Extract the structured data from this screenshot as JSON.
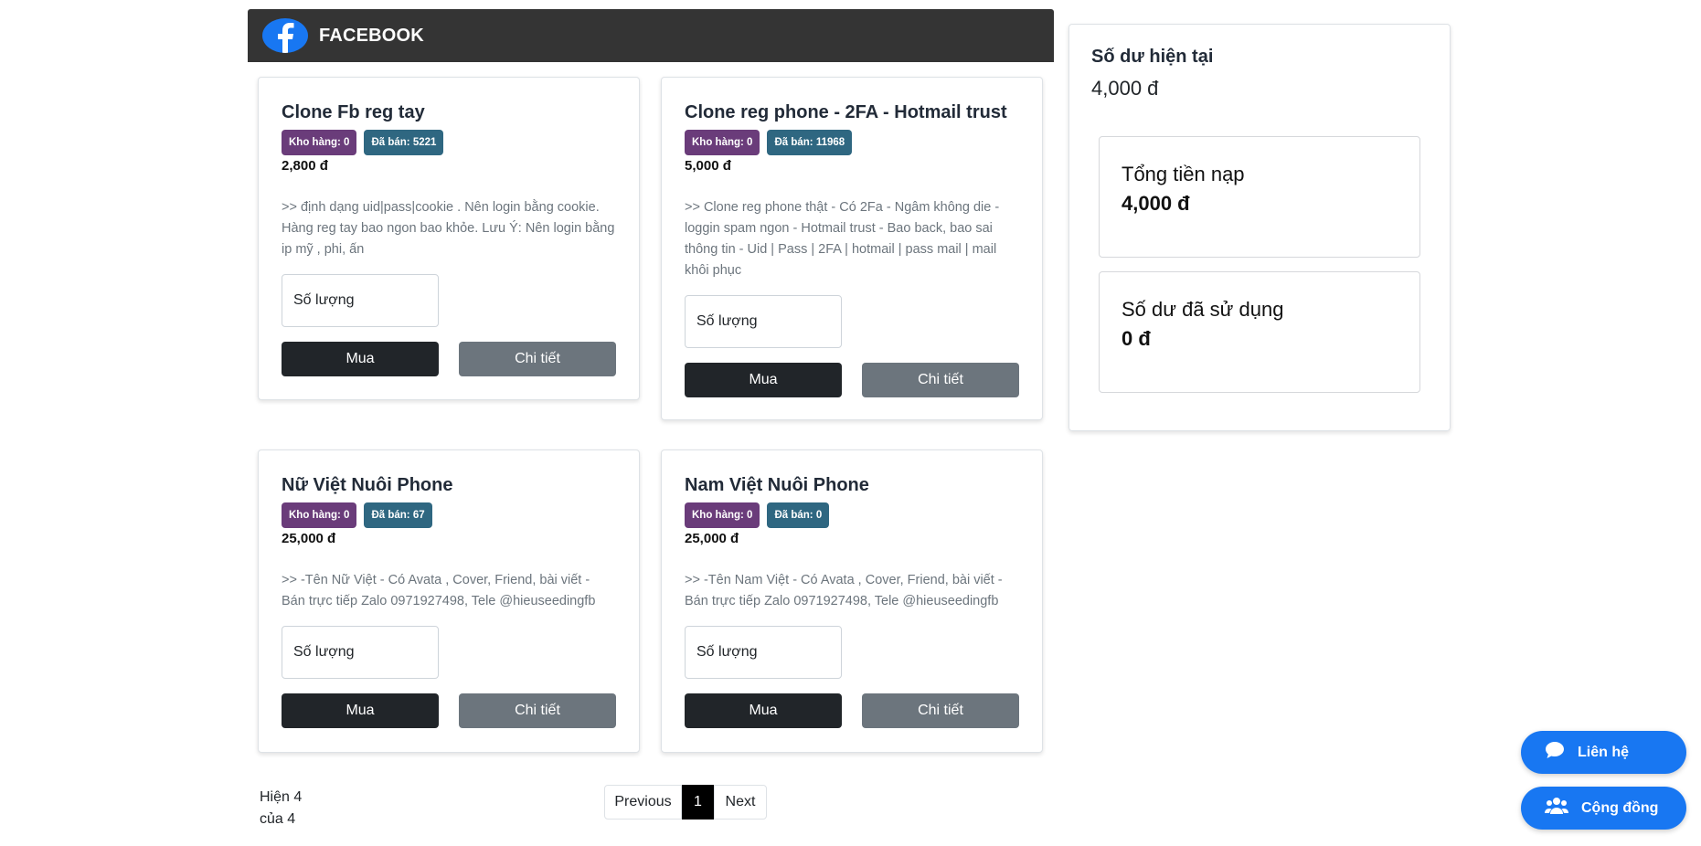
{
  "category": {
    "title": "FACEBOOK",
    "icon": "facebook-logo-icon"
  },
  "products": [
    {
      "name": "Clone Fb reg tay",
      "stock": "Kho hàng: 0",
      "sold": "Đã bán: 5221",
      "price": "2,800 đ",
      "description": ">> định dạng uid|pass|cookie . Nên login bằng cookie. Hàng reg tay bao ngon bao khỏe. Lưu Ý: Nên login bằng ip mỹ , phi, ấn",
      "quantity_placeholder": "Số lượng",
      "buy_label": "Mua",
      "detail_label": "Chi tiết"
    },
    {
      "name": "Clone reg phone - 2FA - Hotmail trust",
      "stock": "Kho hàng: 0",
      "sold": "Đã bán: 11968",
      "price": "5,000 đ",
      "description": ">> Clone reg phone thật - Có 2Fa - Ngâm không die - loggin spam ngon - Hotmail trust - Bao back, bao sai thông tin - Uid | Pass | 2FA | hotmail | pass mail | mail khôi phục",
      "quantity_placeholder": "Số lượng",
      "buy_label": "Mua",
      "detail_label": "Chi tiết"
    },
    {
      "name": "Nữ Việt Nuôi Phone",
      "stock": "Kho hàng: 0",
      "sold": "Đã bán: 67",
      "price": "25,000 đ",
      "description": ">> -Tên Nữ Việt - Có Avata , Cover, Friend, bài viết - Bán trực tiếp Zalo 0971927498, Tele @hieuseedingfb",
      "quantity_placeholder": "Số lượng",
      "buy_label": "Mua",
      "detail_label": "Chi tiết"
    },
    {
      "name": "Nam Việt Nuôi Phone",
      "stock": "Kho hàng: 0",
      "sold": "Đã bán: 0",
      "price": "25,000 đ",
      "description": ">> -Tên Nam Việt - Có Avata , Cover, Friend, bài viết - Bán trực tiếp Zalo 0971927498, Tele @hieuseedingfb",
      "quantity_placeholder": "Số lượng",
      "buy_label": "Mua",
      "detail_label": "Chi tiết"
    }
  ],
  "balance": {
    "title": "Số dư hiện tại",
    "value": "4,000 đ",
    "total_deposit_label": "Tổng tiền nạp",
    "total_deposit_value": "4,000 đ",
    "used_label": "Số dư đã sử dụng",
    "used_value": "0 đ"
  },
  "pagination": {
    "info_line1": "Hiện 4",
    "info_line2": "của 4",
    "previous": "Previous",
    "current": "1",
    "next": "Next"
  },
  "floating": {
    "contact_label": "Liên hệ",
    "contact_icon": "chat-bubble-icon",
    "community_label": "Cộng đồng",
    "community_icon": "users-group-icon"
  },
  "colors": {
    "header_bg": "#343434",
    "facebook_blue": "#1877f2",
    "badge_stock": "#6a3c7a",
    "badge_sold": "#2f6781",
    "buy_button": "#212529",
    "detail_button": "#6c757d"
  }
}
